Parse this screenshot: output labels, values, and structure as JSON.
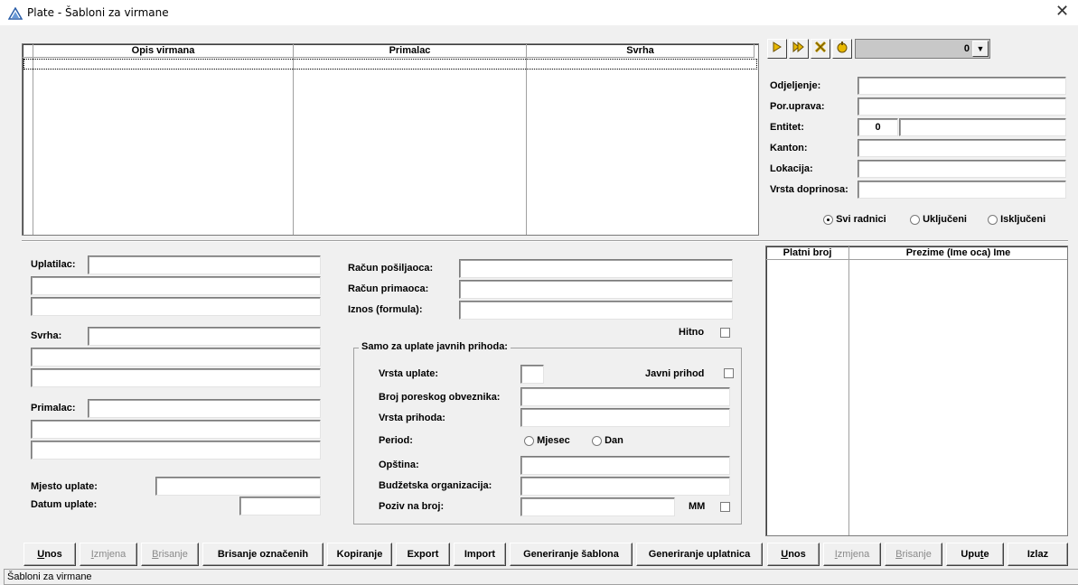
{
  "window": {
    "title": "Plate - Šabloni za virmane",
    "close_glyph": "✕"
  },
  "top_grid": {
    "columns": [
      "Opis virmana",
      "Primalac",
      "Svrha"
    ]
  },
  "filter": {
    "combo_value": "0",
    "odjeljenje_label": "Odjeljenje:",
    "por_uprava_label": "Por.uprava:",
    "entitet_label": "Entitet:",
    "entitet_value": "0",
    "kanton_label": "Kanton:",
    "lokacija_label": "Lokacija:",
    "vrsta_doprinosa_label": "Vrsta doprinosa:",
    "radio_svi": "Svi radnici",
    "radio_ukljuceni": "Uključeni",
    "radio_iskljuceni": "Isključeni"
  },
  "toolbar_icons": [
    "arrow-right-icon",
    "double-arrow-icon",
    "cross-icon",
    "refresh-icon"
  ],
  "right_grid": {
    "columns": [
      "Platni broj",
      "Prezime (Ime oca) Ime"
    ]
  },
  "form": {
    "uplatilac_label": "Uplatilac:",
    "svrha_label": "Svrha:",
    "primalac_label": "Primalac:",
    "mjesto_label": "Mjesto uplate:",
    "datum_label": "Datum uplate:",
    "racun_posiljaoca_label": "Račun pošiljaoca:",
    "racun_primaoca_label": "Račun primaoca:",
    "iznos_label": "Iznos (formula):",
    "hitno_label": "Hitno",
    "group_title": "Samo za uplate javnih prihoda:",
    "vrsta_uplate_label": "Vrsta uplate:",
    "javni_prihod_label": "Javni prihod",
    "broj_poreskog_label": "Broj poreskog obveznika:",
    "vrsta_prihoda_label": "Vrsta prihoda:",
    "period_label": "Period:",
    "period_mjesec": "Mjesec",
    "period_dan": "Dan",
    "opstina_label": "Opština:",
    "budzetska_label": "Budžetska organizacija:",
    "poziv_label": "Poziv na broj:",
    "mm_label": "MM"
  },
  "buttons": {
    "unos": {
      "pre": "",
      "u": "U",
      "post": "nos"
    },
    "izmjena": {
      "pre": "",
      "u": "I",
      "post": "zmjena"
    },
    "brisanje": {
      "pre": "",
      "u": "B",
      "post": "risanje"
    },
    "brisanje_oznacenih": "Brisanje označenih",
    "kopiranje": "Kopiranje",
    "export": "Export",
    "import": "Import",
    "generiranje_sablona": "Generiranje šablona",
    "generiranje_uplatnica": "Generiranje uplatnica",
    "unos2": {
      "pre": "",
      "u": "U",
      "post": "nos"
    },
    "izmjena2": {
      "pre": "",
      "u": "I",
      "post": "zmjena"
    },
    "brisanje2": {
      "pre": "",
      "u": "B",
      "post": "risanje"
    },
    "upute": {
      "pre": "Upu",
      "u": "t",
      "post": "e"
    },
    "izlaz": "Izlaz"
  },
  "status": {
    "text": "Šabloni za virmane"
  }
}
